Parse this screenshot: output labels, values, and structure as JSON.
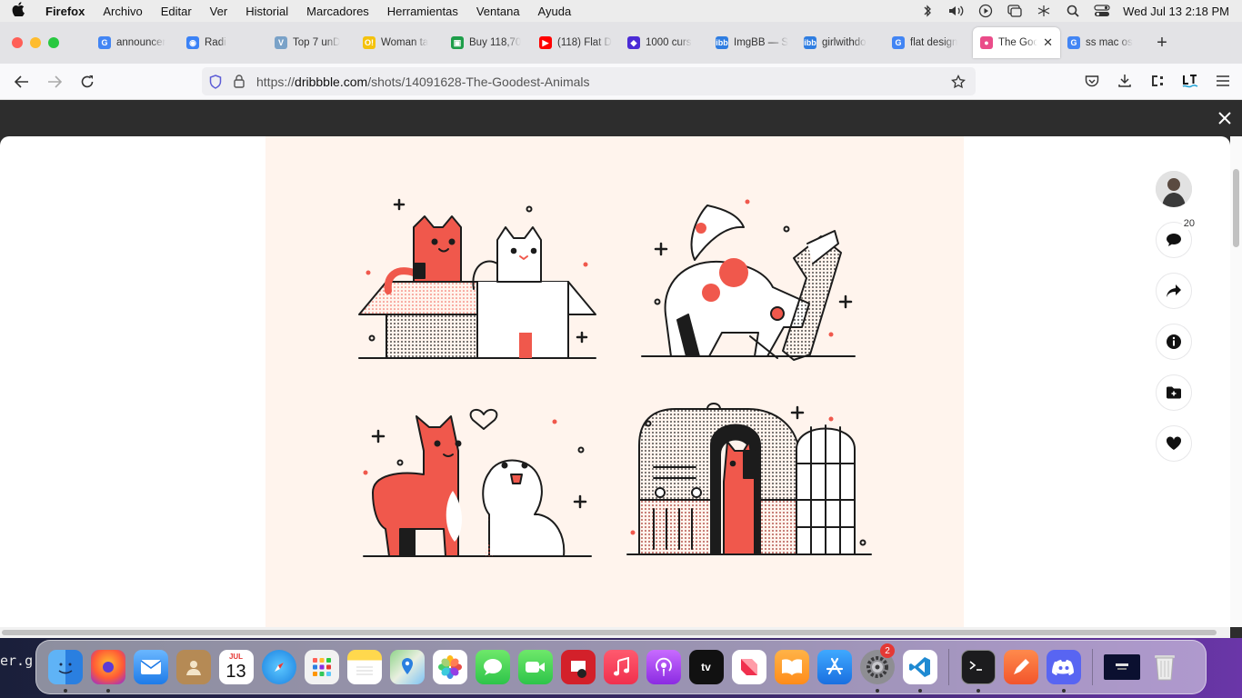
{
  "menubar": {
    "app_name": "Firefox",
    "menus": [
      "Archivo",
      "Editar",
      "Ver",
      "Historial",
      "Marcadores",
      "Herramientas",
      "Ventana",
      "Ayuda"
    ],
    "clock": "Wed Jul 13  2:18 PM"
  },
  "tabs": [
    {
      "label": "announcer",
      "fav_color": "#4285f4",
      "fav_text": "G"
    },
    {
      "label": "Radi",
      "fav_color": "#3b82f6",
      "fav_text": "◉"
    },
    {
      "label": "Top 7 unD",
      "fav_color": "#7aa2c8",
      "fav_text": "V"
    },
    {
      "label": "Woman ta",
      "fav_color": "#f4c20d",
      "fav_text": "O!"
    },
    {
      "label": "Buy 118,70",
      "fav_color": "#1e9e4a",
      "fav_text": "▣"
    },
    {
      "label": "(118) Flat D",
      "fav_color": "#ff0000",
      "fav_text": "▶"
    },
    {
      "label": "1000 curs",
      "fav_color": "#4b2bd6",
      "fav_text": "◆"
    },
    {
      "label": "ImgBB — S",
      "fav_color": "#2f7de1",
      "fav_text": "ibb"
    },
    {
      "label": "girlwithdo",
      "fav_color": "#2f7de1",
      "fav_text": "ibb"
    },
    {
      "label": "flat design",
      "fav_color": "#4285f4",
      "fav_text": "G"
    },
    {
      "label": "The Goo",
      "fav_color": "#ea4c89",
      "fav_text": "●",
      "active": true
    },
    {
      "label": "ss mac os",
      "fav_color": "#4285f4",
      "fav_text": "G"
    }
  ],
  "url": {
    "prefix": "https://",
    "domain": "dribbble.com",
    "path": "/shots/14091628-The-Goodest-Animals"
  },
  "shot": {
    "background": "#fff4ed",
    "accent": "#f0584c",
    "ink": "#1c1c1c"
  },
  "actions": {
    "comment_count": "20"
  },
  "desktop": {
    "terminal_fragment": "er.g"
  },
  "dock": {
    "calendar_month": "JUL",
    "calendar_day": "13",
    "settings_badge": "2",
    "appletv_label": "tv"
  }
}
